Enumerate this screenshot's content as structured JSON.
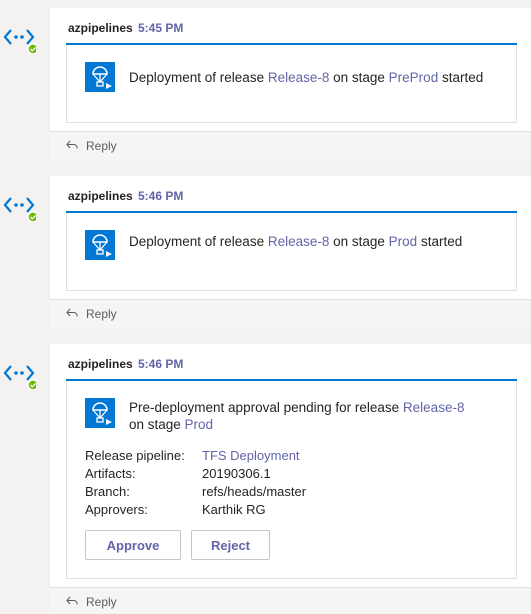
{
  "messages": [
    {
      "sender": "azpipelines",
      "time": "5:45 PM",
      "text_a": "Deployment of release ",
      "release": "Release-8",
      "text_b": " on stage ",
      "stage": "PreProd",
      "text_c": " started",
      "reply": "Reply"
    },
    {
      "sender": "azpipelines",
      "time": "5:46 PM",
      "text_a": "Deployment of release ",
      "release": "Release-8",
      "text_b": " on stage ",
      "stage": "Prod",
      "text_c": " started",
      "reply": "Reply"
    },
    {
      "sender": "azpipelines",
      "time": "5:46 PM",
      "text_a": "Pre-deployment approval pending for release ",
      "release": "Release-8",
      "text_b": "on stage ",
      "stage": "Prod",
      "facts": [
        {
          "key": "Release pipeline:",
          "value": "TFS Deployment"
        },
        {
          "key": "Artifacts:",
          "value": "20190306.1"
        },
        {
          "key": "Branch:",
          "value": "refs/heads/master"
        },
        {
          "key": "Approvers:",
          "value": "Karthik RG"
        }
      ],
      "approve_label": "Approve",
      "reject_label": "Reject",
      "reply": "Reply"
    }
  ],
  "colors": {
    "accent": "#0078d4",
    "link": "#6264a7",
    "presence": "#6bb700"
  },
  "icons": {
    "avatar": "azure-pipelines-icon",
    "presence": "available-check-icon",
    "card": "rocket-release-icon",
    "reply": "reply-arrow-icon"
  }
}
